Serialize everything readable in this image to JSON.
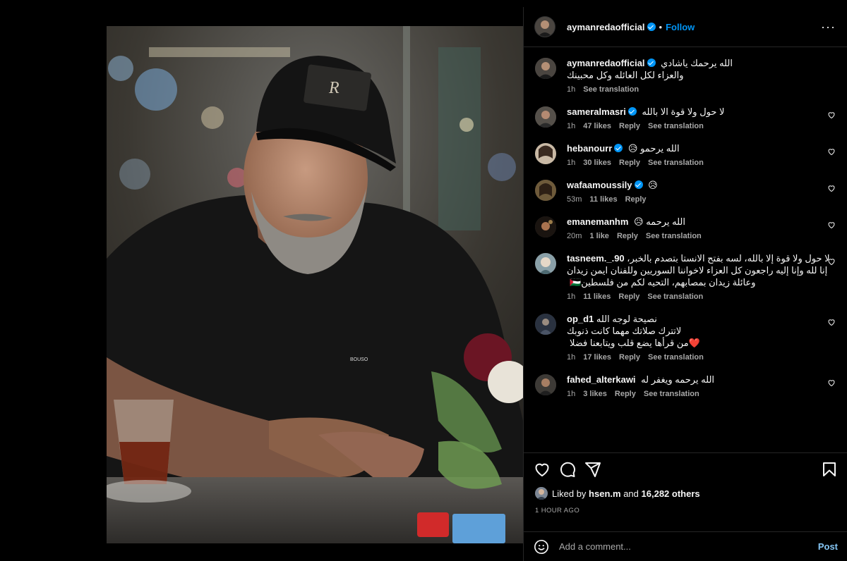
{
  "post": {
    "author": "aymanredaofficial",
    "follow_label": "Follow",
    "dot": "•",
    "more": "···",
    "caption_lines": [
      "الله يرحمك ياشادي",
      "والعزاء لكل العائله وكل محبينك"
    ],
    "caption_time": "1h",
    "caption_translate": "See translation",
    "photo_badge_text": "BOUSO"
  },
  "comments": [
    {
      "user": "sameralmasri",
      "verified": true,
      "text": "لا حول ولا قوة الا بالله",
      "time": "1h",
      "likes": "47 likes",
      "reply": "Reply",
      "translate": "See translation"
    },
    {
      "user": "hebanourr",
      "verified": true,
      "text": "الله يرحمو 😥",
      "time": "1h",
      "likes": "30 likes",
      "reply": "Reply",
      "translate": "See translation"
    },
    {
      "user": "wafaamoussily",
      "verified": true,
      "text": "😥",
      "time": "53m",
      "likes": "11 likes",
      "reply": "Reply",
      "translate": ""
    },
    {
      "user": "emanemanhm",
      "verified": false,
      "text": "الله يرحمه 😥",
      "time": "20m",
      "likes": "1 like",
      "reply": "Reply",
      "translate": "See translation"
    },
    {
      "user": "tasneem._.90",
      "verified": false,
      "text": "لا حول ولا قوة إلا بالله، لسه بفتح الانستا بتصدم بالخبر، إنا لله وإنا إليه راجعون كل العزاء لاخواننا السوريين وللفنان ايمن زيدان وعائلة زيدان بمصابهم، التحيه لكم من فلسطين🇵🇸",
      "time": "1h",
      "likes": "11 likes",
      "reply": "Reply",
      "translate": "See translation"
    },
    {
      "user": "op_d1",
      "verified": false,
      "text": "نصيحة لوجه الله\nلاتترك صلاتك مهما كانت ذنوبك\n❤️من قرأها يضع قلب ويتابعنا فضلا",
      "time": "1h",
      "likes": "17 likes",
      "reply": "Reply",
      "translate": "See translation"
    },
    {
      "user": "fahed_alterkawi",
      "verified": false,
      "text": "الله يرحمه ويغفر له",
      "time": "1h",
      "likes": "3 likes",
      "reply": "Reply",
      "translate": "See translation"
    }
  ],
  "likes": {
    "prefix": "Liked by",
    "user": "hsen.m",
    "joiner": "and",
    "others": "16,282 others"
  },
  "timestamp": "1 HOUR AGO",
  "composer": {
    "placeholder": "Add a comment...",
    "post_label": "Post"
  },
  "colors": {
    "accent": "#0095f6",
    "post_disabled": "#85c6f5",
    "muted": "#a8a8a8",
    "divider": "#262626"
  },
  "icons": [
    "heart-icon",
    "comment-icon",
    "share-icon",
    "bookmark-icon",
    "emoji-icon",
    "more-icon",
    "verified-icon"
  ]
}
